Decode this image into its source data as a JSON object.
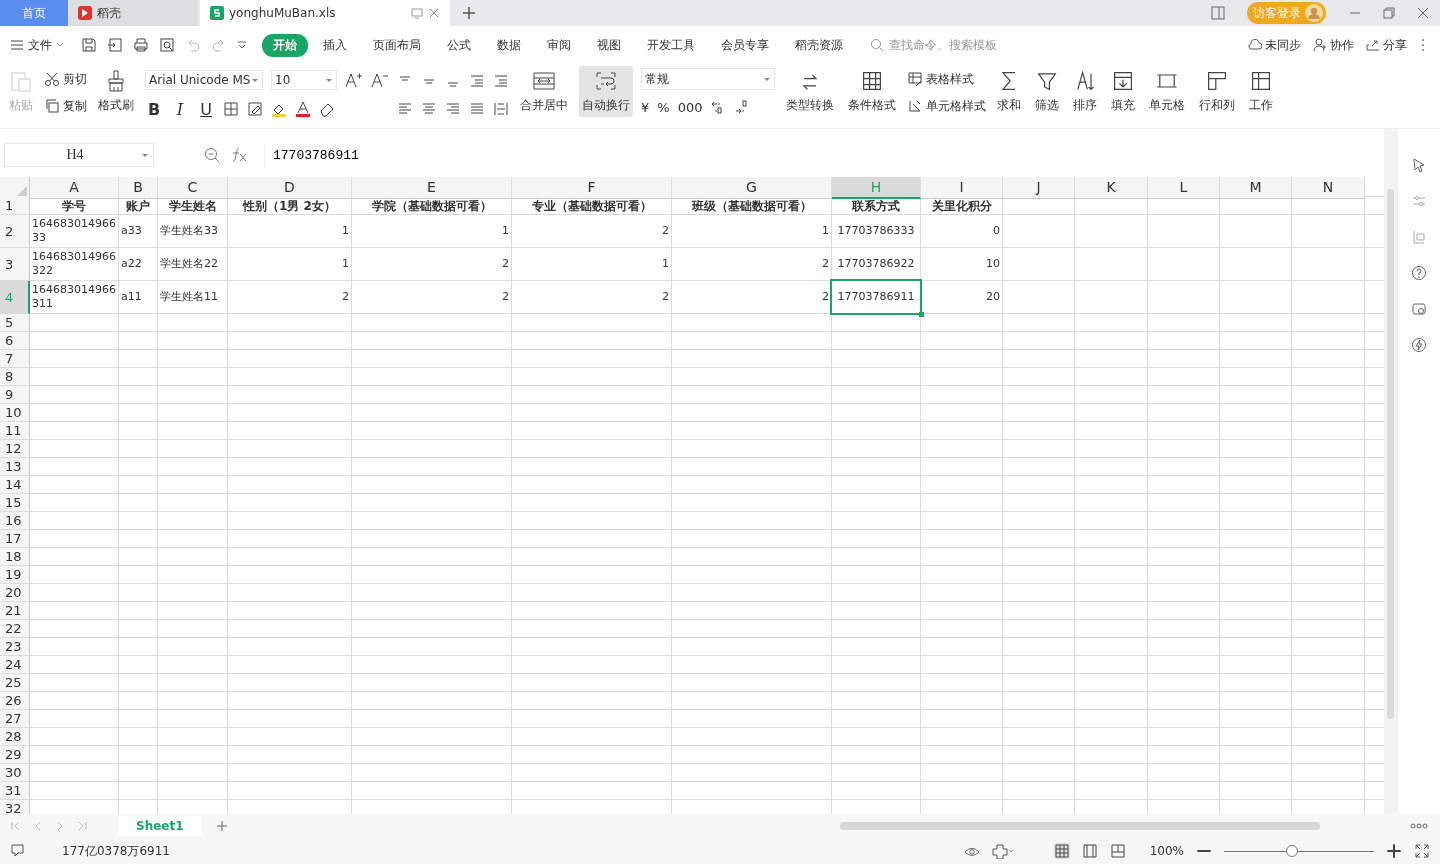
{
  "title_tabs": [
    {
      "label": "首页",
      "kind": "home",
      "selected": false
    },
    {
      "label": "稻壳",
      "kind": "docer",
      "selected": false
    },
    {
      "label": "yonghuMuBan.xls",
      "kind": "file",
      "selected": true
    }
  ],
  "login": "访客登录",
  "menu": {
    "file": "文件",
    "tabs": [
      {
        "label": "开始",
        "selected": true
      },
      {
        "label": "插入",
        "selected": false
      },
      {
        "label": "页面布局",
        "selected": false
      },
      {
        "label": "公式",
        "selected": false
      },
      {
        "label": "数据",
        "selected": false
      },
      {
        "label": "审阅",
        "selected": false
      },
      {
        "label": "视图",
        "selected": false
      },
      {
        "label": "开发工具",
        "selected": false
      },
      {
        "label": "会员专享",
        "selected": false
      },
      {
        "label": "稻壳资源",
        "selected": false
      }
    ],
    "search": {
      "placeholder": "查找命令、搜索模板"
    },
    "actions": [
      "未同步",
      "协作",
      "分享"
    ]
  },
  "ribbon": {
    "paste": {
      "label": "粘贴",
      "disabled": true
    },
    "clipboard": [
      "剪切",
      "复制"
    ],
    "format_painter": "格式刷",
    "font": {
      "name": "Arial Unicode MS",
      "size": "10"
    },
    "font_buttons": [
      "B",
      "I",
      "U"
    ],
    "merge": "合并居中",
    "wrap": {
      "label": "自动换行",
      "selected": true
    },
    "number_format": "常规",
    "number_buttons": [
      "¥",
      "%",
      "000"
    ],
    "tools": [
      "类型转换",
      "条件格式"
    ],
    "styles": [
      "表格样式",
      "单元格样式"
    ],
    "more_tools": [
      "求和",
      "筛选",
      "排序",
      "填充",
      "单元格",
      "行和列",
      "工作"
    ]
  },
  "formula_bar": {
    "cell": "H4",
    "value": "17703786911"
  },
  "columns": [
    {
      "label": "A",
      "selected": false
    },
    {
      "label": "B",
      "selected": false
    },
    {
      "label": "C",
      "selected": false
    },
    {
      "label": "D",
      "selected": false
    },
    {
      "label": "E",
      "selected": false
    },
    {
      "label": "F",
      "selected": false
    },
    {
      "label": "G",
      "selected": false
    },
    {
      "label": "H",
      "selected": true
    },
    {
      "label": "I",
      "selected": false
    },
    {
      "label": "J",
      "selected": false
    },
    {
      "label": "K",
      "selected": false
    },
    {
      "label": "L",
      "selected": false
    },
    {
      "label": "M",
      "selected": false
    },
    {
      "label": "N",
      "selected": false
    }
  ],
  "rows": [
    {
      "number": "1",
      "selected": false,
      "kind": "header",
      "cells": [
        "学号",
        "账户",
        "学生姓名",
        "性别（1男 2女）",
        "学院（基础数据可看）",
        "专业（基础数据可看）",
        "班级（基础数据可看）",
        "联系方式",
        "关里化积分"
      ]
    },
    {
      "number": "2",
      "selected": false,
      "kind": "data",
      "cells": [
        "16468301496633",
        "a33",
        "学生姓名33",
        "1",
        "1",
        "2",
        "1",
        "17703786333",
        "0"
      ]
    },
    {
      "number": "3",
      "selected": false,
      "kind": "data",
      "cells": [
        "164683014966322",
        "a22",
        "学生姓名22",
        "1",
        "2",
        "1",
        "2",
        "17703786922",
        "10"
      ]
    },
    {
      "number": "4",
      "selected": true,
      "kind": "data",
      "cells": [
        "164683014966311",
        "a11",
        "学生姓名11",
        "2",
        "2",
        "2",
        "2",
        "17703786911",
        "20"
      ]
    },
    {
      "number": "5",
      "selected": false
    },
    {
      "number": "6",
      "selected": false
    },
    {
      "number": "7",
      "selected": false
    },
    {
      "number": "8",
      "selected": false
    },
    {
      "number": "9",
      "selected": false
    },
    {
      "number": "10",
      "selected": false
    },
    {
      "number": "11",
      "selected": false
    },
    {
      "number": "12",
      "selected": false
    },
    {
      "number": "13",
      "selected": false
    },
    {
      "number": "14",
      "selected": false
    },
    {
      "number": "15",
      "selected": false
    },
    {
      "number": "16",
      "selected": false
    },
    {
      "number": "17",
      "selected": false
    },
    {
      "number": "18",
      "selected": false
    },
    {
      "number": "19",
      "selected": false
    },
    {
      "number": "20",
      "selected": false
    },
    {
      "number": "21",
      "selected": false
    },
    {
      "number": "22",
      "selected": false
    },
    {
      "number": "23",
      "selected": false
    },
    {
      "number": "24",
      "selected": false
    },
    {
      "number": "25",
      "selected": false
    },
    {
      "number": "26",
      "selected": false
    },
    {
      "number": "27",
      "selected": false
    },
    {
      "number": "28",
      "selected": false
    },
    {
      "number": "29",
      "selected": false
    },
    {
      "number": "30",
      "selected": false
    },
    {
      "number": "31",
      "selected": false
    },
    {
      "number": "32",
      "selected": false
    }
  ],
  "sheets": [
    {
      "label": "Sheet1",
      "selected": true
    }
  ],
  "status": {
    "text": "177亿0378万6911",
    "zoom": "100%",
    "level": 0.45
  }
}
